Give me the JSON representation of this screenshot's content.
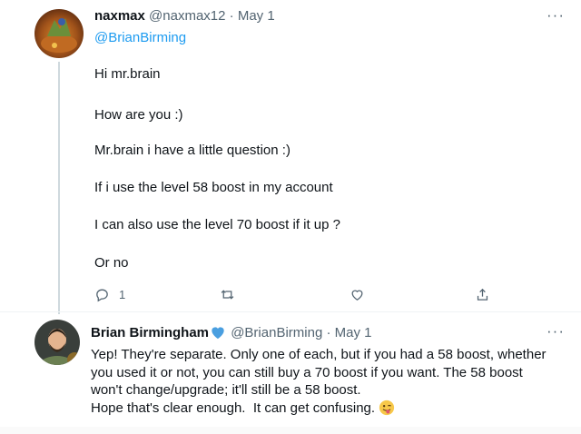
{
  "tweet1": {
    "name": "naxmax",
    "handle": "@naxmax12",
    "separator": "·",
    "date": "May 1",
    "reply_to": "@BrianBirming",
    "lines": [
      "Hi mr.brain",
      "How are you :)",
      "Mr.brain i have a little question :)",
      "If i use the level 58 boost in my account",
      "I can also use the level 70 boost if it up ?",
      "Or no"
    ],
    "actions": {
      "reply_count": "1",
      "reply_icon": "reply-icon",
      "retweet_icon": "retweet-icon",
      "like_icon": "heart-icon",
      "share_icon": "share-icon"
    },
    "more": "···"
  },
  "tweet2": {
    "name": "Brian Birmingham",
    "verified_icon": "blue-heart-icon",
    "handle": "@BrianBirming",
    "separator": "·",
    "date": "May 1",
    "lines": [
      "Yep! They're separate. Only one of each, but if you had a 58 boost, whether",
      "you used it or not, you can still buy a 70 boost if you want. The 58 boost",
      "won't change/upgrade; it'll still be a 58 boost.",
      "Hope that's clear enough.  It can get confusing."
    ],
    "emoji_icon": "winking-face-tongue-emoji",
    "more": "···"
  },
  "colors": {
    "text": "#0f1419",
    "secondary": "#536471",
    "link": "#1d9bf0",
    "verified": "#4a9fe0"
  }
}
